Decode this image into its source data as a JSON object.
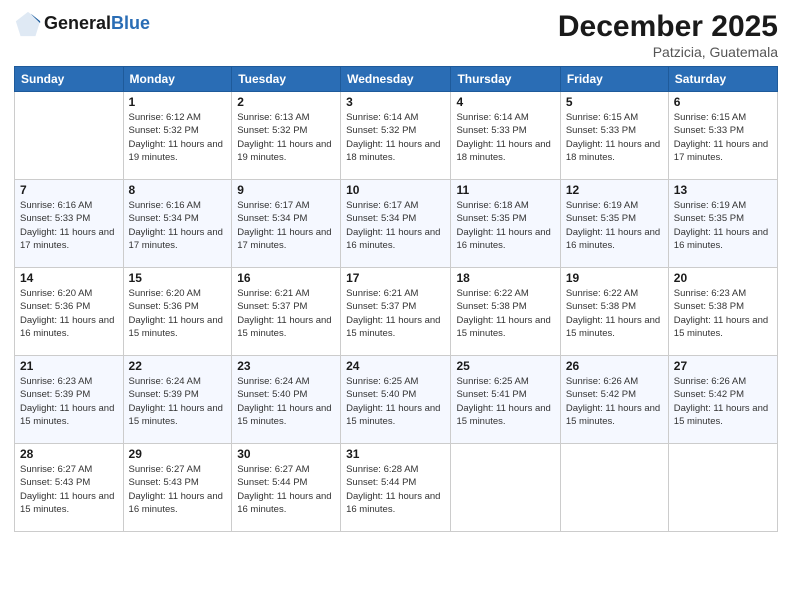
{
  "logo": {
    "line1": "General",
    "line2": "Blue"
  },
  "title": "December 2025",
  "subtitle": "Patzicia, Guatemala",
  "headers": [
    "Sunday",
    "Monday",
    "Tuesday",
    "Wednesday",
    "Thursday",
    "Friday",
    "Saturday"
  ],
  "weeks": [
    [
      {
        "day": "",
        "sunrise": "",
        "sunset": "",
        "daylight": ""
      },
      {
        "day": "1",
        "sunrise": "6:12 AM",
        "sunset": "5:32 PM",
        "daylight": "11 hours and 19 minutes."
      },
      {
        "day": "2",
        "sunrise": "6:13 AM",
        "sunset": "5:32 PM",
        "daylight": "11 hours and 19 minutes."
      },
      {
        "day": "3",
        "sunrise": "6:14 AM",
        "sunset": "5:32 PM",
        "daylight": "11 hours and 18 minutes."
      },
      {
        "day": "4",
        "sunrise": "6:14 AM",
        "sunset": "5:33 PM",
        "daylight": "11 hours and 18 minutes."
      },
      {
        "day": "5",
        "sunrise": "6:15 AM",
        "sunset": "5:33 PM",
        "daylight": "11 hours and 18 minutes."
      },
      {
        "day": "6",
        "sunrise": "6:15 AM",
        "sunset": "5:33 PM",
        "daylight": "11 hours and 17 minutes."
      }
    ],
    [
      {
        "day": "7",
        "sunrise": "6:16 AM",
        "sunset": "5:33 PM",
        "daylight": "11 hours and 17 minutes."
      },
      {
        "day": "8",
        "sunrise": "6:16 AM",
        "sunset": "5:34 PM",
        "daylight": "11 hours and 17 minutes."
      },
      {
        "day": "9",
        "sunrise": "6:17 AM",
        "sunset": "5:34 PM",
        "daylight": "11 hours and 17 minutes."
      },
      {
        "day": "10",
        "sunrise": "6:17 AM",
        "sunset": "5:34 PM",
        "daylight": "11 hours and 16 minutes."
      },
      {
        "day": "11",
        "sunrise": "6:18 AM",
        "sunset": "5:35 PM",
        "daylight": "11 hours and 16 minutes."
      },
      {
        "day": "12",
        "sunrise": "6:19 AM",
        "sunset": "5:35 PM",
        "daylight": "11 hours and 16 minutes."
      },
      {
        "day": "13",
        "sunrise": "6:19 AM",
        "sunset": "5:35 PM",
        "daylight": "11 hours and 16 minutes."
      }
    ],
    [
      {
        "day": "14",
        "sunrise": "6:20 AM",
        "sunset": "5:36 PM",
        "daylight": "11 hours and 16 minutes."
      },
      {
        "day": "15",
        "sunrise": "6:20 AM",
        "sunset": "5:36 PM",
        "daylight": "11 hours and 15 minutes."
      },
      {
        "day": "16",
        "sunrise": "6:21 AM",
        "sunset": "5:37 PM",
        "daylight": "11 hours and 15 minutes."
      },
      {
        "day": "17",
        "sunrise": "6:21 AM",
        "sunset": "5:37 PM",
        "daylight": "11 hours and 15 minutes."
      },
      {
        "day": "18",
        "sunrise": "6:22 AM",
        "sunset": "5:38 PM",
        "daylight": "11 hours and 15 minutes."
      },
      {
        "day": "19",
        "sunrise": "6:22 AM",
        "sunset": "5:38 PM",
        "daylight": "11 hours and 15 minutes."
      },
      {
        "day": "20",
        "sunrise": "6:23 AM",
        "sunset": "5:38 PM",
        "daylight": "11 hours and 15 minutes."
      }
    ],
    [
      {
        "day": "21",
        "sunrise": "6:23 AM",
        "sunset": "5:39 PM",
        "daylight": "11 hours and 15 minutes."
      },
      {
        "day": "22",
        "sunrise": "6:24 AM",
        "sunset": "5:39 PM",
        "daylight": "11 hours and 15 minutes."
      },
      {
        "day": "23",
        "sunrise": "6:24 AM",
        "sunset": "5:40 PM",
        "daylight": "11 hours and 15 minutes."
      },
      {
        "day": "24",
        "sunrise": "6:25 AM",
        "sunset": "5:40 PM",
        "daylight": "11 hours and 15 minutes."
      },
      {
        "day": "25",
        "sunrise": "6:25 AM",
        "sunset": "5:41 PM",
        "daylight": "11 hours and 15 minutes."
      },
      {
        "day": "26",
        "sunrise": "6:26 AM",
        "sunset": "5:42 PM",
        "daylight": "11 hours and 15 minutes."
      },
      {
        "day": "27",
        "sunrise": "6:26 AM",
        "sunset": "5:42 PM",
        "daylight": "11 hours and 15 minutes."
      }
    ],
    [
      {
        "day": "28",
        "sunrise": "6:27 AM",
        "sunset": "5:43 PM",
        "daylight": "11 hours and 15 minutes."
      },
      {
        "day": "29",
        "sunrise": "6:27 AM",
        "sunset": "5:43 PM",
        "daylight": "11 hours and 16 minutes."
      },
      {
        "day": "30",
        "sunrise": "6:27 AM",
        "sunset": "5:44 PM",
        "daylight": "11 hours and 16 minutes."
      },
      {
        "day": "31",
        "sunrise": "6:28 AM",
        "sunset": "5:44 PM",
        "daylight": "11 hours and 16 minutes."
      },
      {
        "day": "",
        "sunrise": "",
        "sunset": "",
        "daylight": ""
      },
      {
        "day": "",
        "sunrise": "",
        "sunset": "",
        "daylight": ""
      },
      {
        "day": "",
        "sunrise": "",
        "sunset": "",
        "daylight": ""
      }
    ]
  ],
  "labels": {
    "sunrise_prefix": "Sunrise: ",
    "sunset_prefix": "Sunset: ",
    "daylight_prefix": "Daylight: "
  }
}
